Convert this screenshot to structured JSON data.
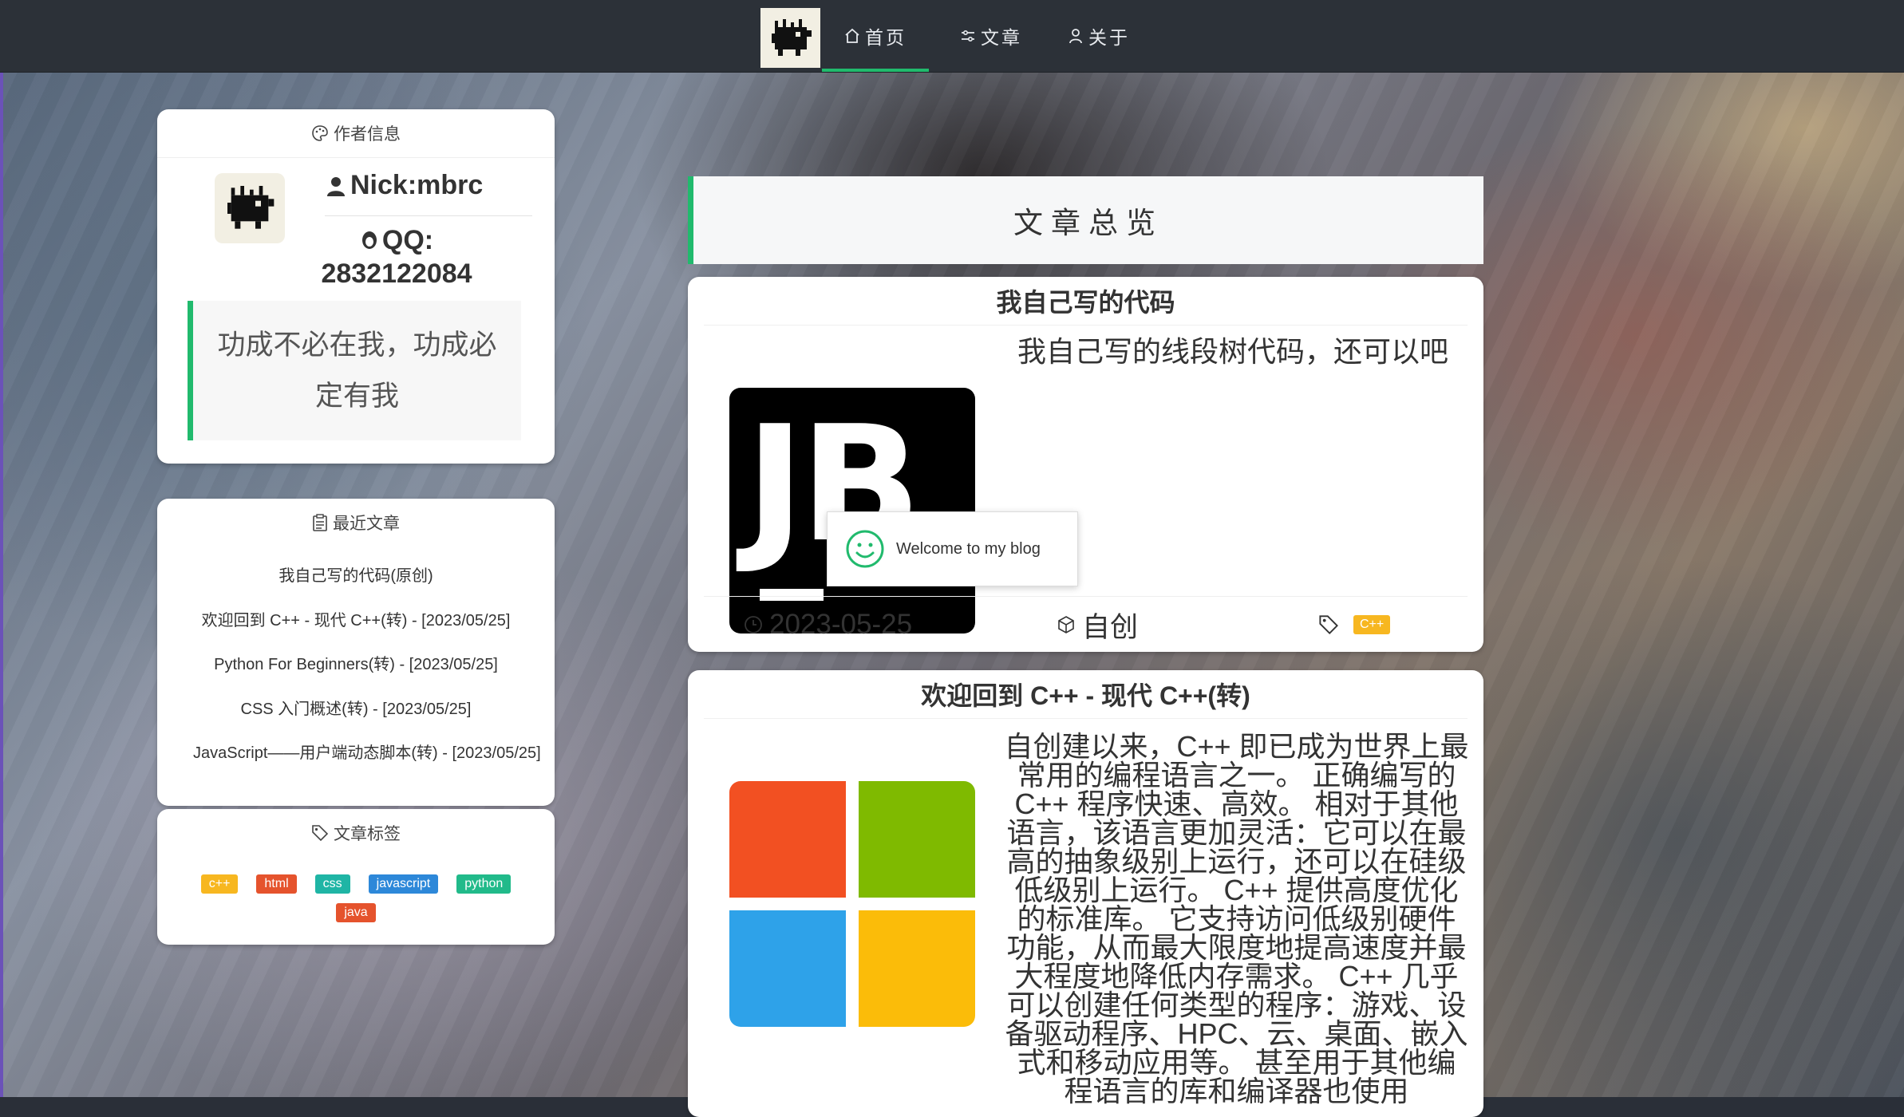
{
  "nav": {
    "items": [
      {
        "label": "首页",
        "icon": "home-icon",
        "active": true
      },
      {
        "label": "文章",
        "icon": "sliders-icon"
      },
      {
        "label": "关于",
        "icon": "user-icon"
      }
    ],
    "accent": "#21ba6d"
  },
  "author": {
    "title": "作者信息",
    "name": "Nick:mbrc",
    "qq_label": "QQ:",
    "qq_number": "2832122084",
    "motto": "功成不必在我，功成必定有我"
  },
  "recent": {
    "title": "最近文章",
    "items": [
      "我自己写的代码(原创)",
      "欢迎回到 C++ - 现代 C++(转) - [2023/05/25]",
      "Python For Beginners(转) - [2023/05/25]",
      "CSS 入门概述(转) - [2023/05/25]",
      "JavaScript——用户端动态脚本(转) - [2023/05/25]"
    ]
  },
  "tags": {
    "title": "文章标签",
    "items": [
      {
        "label": "c++",
        "color": "#f7b720"
      },
      {
        "label": "html",
        "color": "#e5532d"
      },
      {
        "label": "css",
        "color": "#1fb5a5"
      },
      {
        "label": "javascript",
        "color": "#2d88d9"
      },
      {
        "label": "python",
        "color": "#21ba8a"
      },
      {
        "label": "java",
        "color": "#e5532d"
      }
    ]
  },
  "overview": {
    "title": "文章总览"
  },
  "posts": [
    {
      "title": "我自己写的代码",
      "thumb_text": "JB",
      "excerpt": "我自己写的线段树代码，还可以吧",
      "date": "2023-05-25",
      "type": "自创",
      "tag": "C++"
    },
    {
      "title": "欢迎回到 C++ - 现代 C++(转)",
      "excerpt": "自创建以来，C++ 即已成为世界上最常用的编程语言之一。 正确编写的 C++ 程序快速、高效。 相对于其他语言，该语言更加灵活：它可以在最高的抽象级别上运行，还可以在硅级低级别上运行。 C++ 提供高度优化的标准库。 它支持访问低级别硬件功能，从而最大限度地提高速度并最大程度地降低内存需求。 C++ 几乎可以创建任何类型的程序：游戏、设备驱动程序、HPC、云、桌面、嵌入式和移动应用等。 甚至用于其他编程语言的库和编译器也使用"
    }
  ],
  "toast": {
    "text": "Welcome to my blog"
  }
}
